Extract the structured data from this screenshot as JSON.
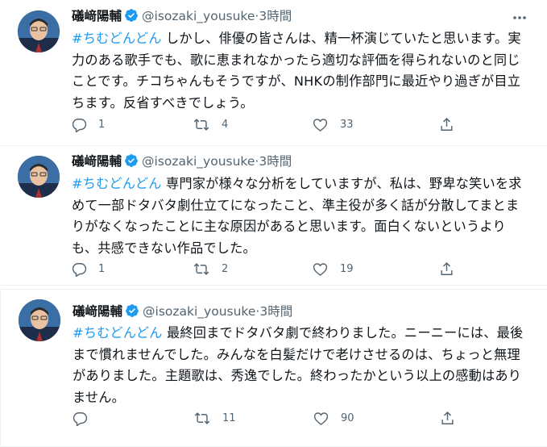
{
  "tweets": [
    {
      "author": "礒﨑陽輔",
      "handle": "@isozaki_yousuke",
      "separator": "·",
      "time": "3時間",
      "hashtag": "#ちむどんどん",
      "text": " しかし、俳優の皆さんは、精一杯演じていたと思います。実力のある歌手でも、歌に恵まれなかったら適切な評価を得られないのと同じことです。チコちゃんもそうですが、NHKの制作部門に最近やり過ぎが目立ちます。反省すべきでしょう。",
      "replies": "1",
      "retweets": "4",
      "likes": "33"
    },
    {
      "author": "礒﨑陽輔",
      "handle": "@isozaki_yousuke",
      "separator": "·",
      "time": "3時間",
      "hashtag": "#ちむどんどん",
      "text": " 専門家が様々な分析をしていますが、私は、野卑な笑いを求めて一部ドタバタ劇仕立てになったこと、準主役が多く話が分散してまとまりがなくなったことに主な原因があると思います。面白くないというよりも、共感できない作品でした。",
      "replies": "1",
      "retweets": "2",
      "likes": "19"
    },
    {
      "author": "礒﨑陽輔",
      "handle": "@isozaki_yousuke",
      "separator": "·",
      "time": "3時間",
      "hashtag": "#ちむどんどん",
      "text": " 最終回までドタバタ劇で終わりました。ニーニーには、最後まで慣れませんでした。みんなを白髪だけで老けさせるのは、ちょっと無理がありました。主題歌は、秀逸でした。終わったかという以上の感動はありません。",
      "replies": "",
      "retweets": "11",
      "likes": "90"
    }
  ],
  "colors": {
    "link": "#1d9bf0",
    "muted": "#536471",
    "text": "#0f1419",
    "verified": "#1d9bf0"
  },
  "icons": [
    "verified-badge-icon",
    "more-options-icon",
    "reply-icon",
    "retweet-icon",
    "like-icon",
    "share-icon"
  ]
}
